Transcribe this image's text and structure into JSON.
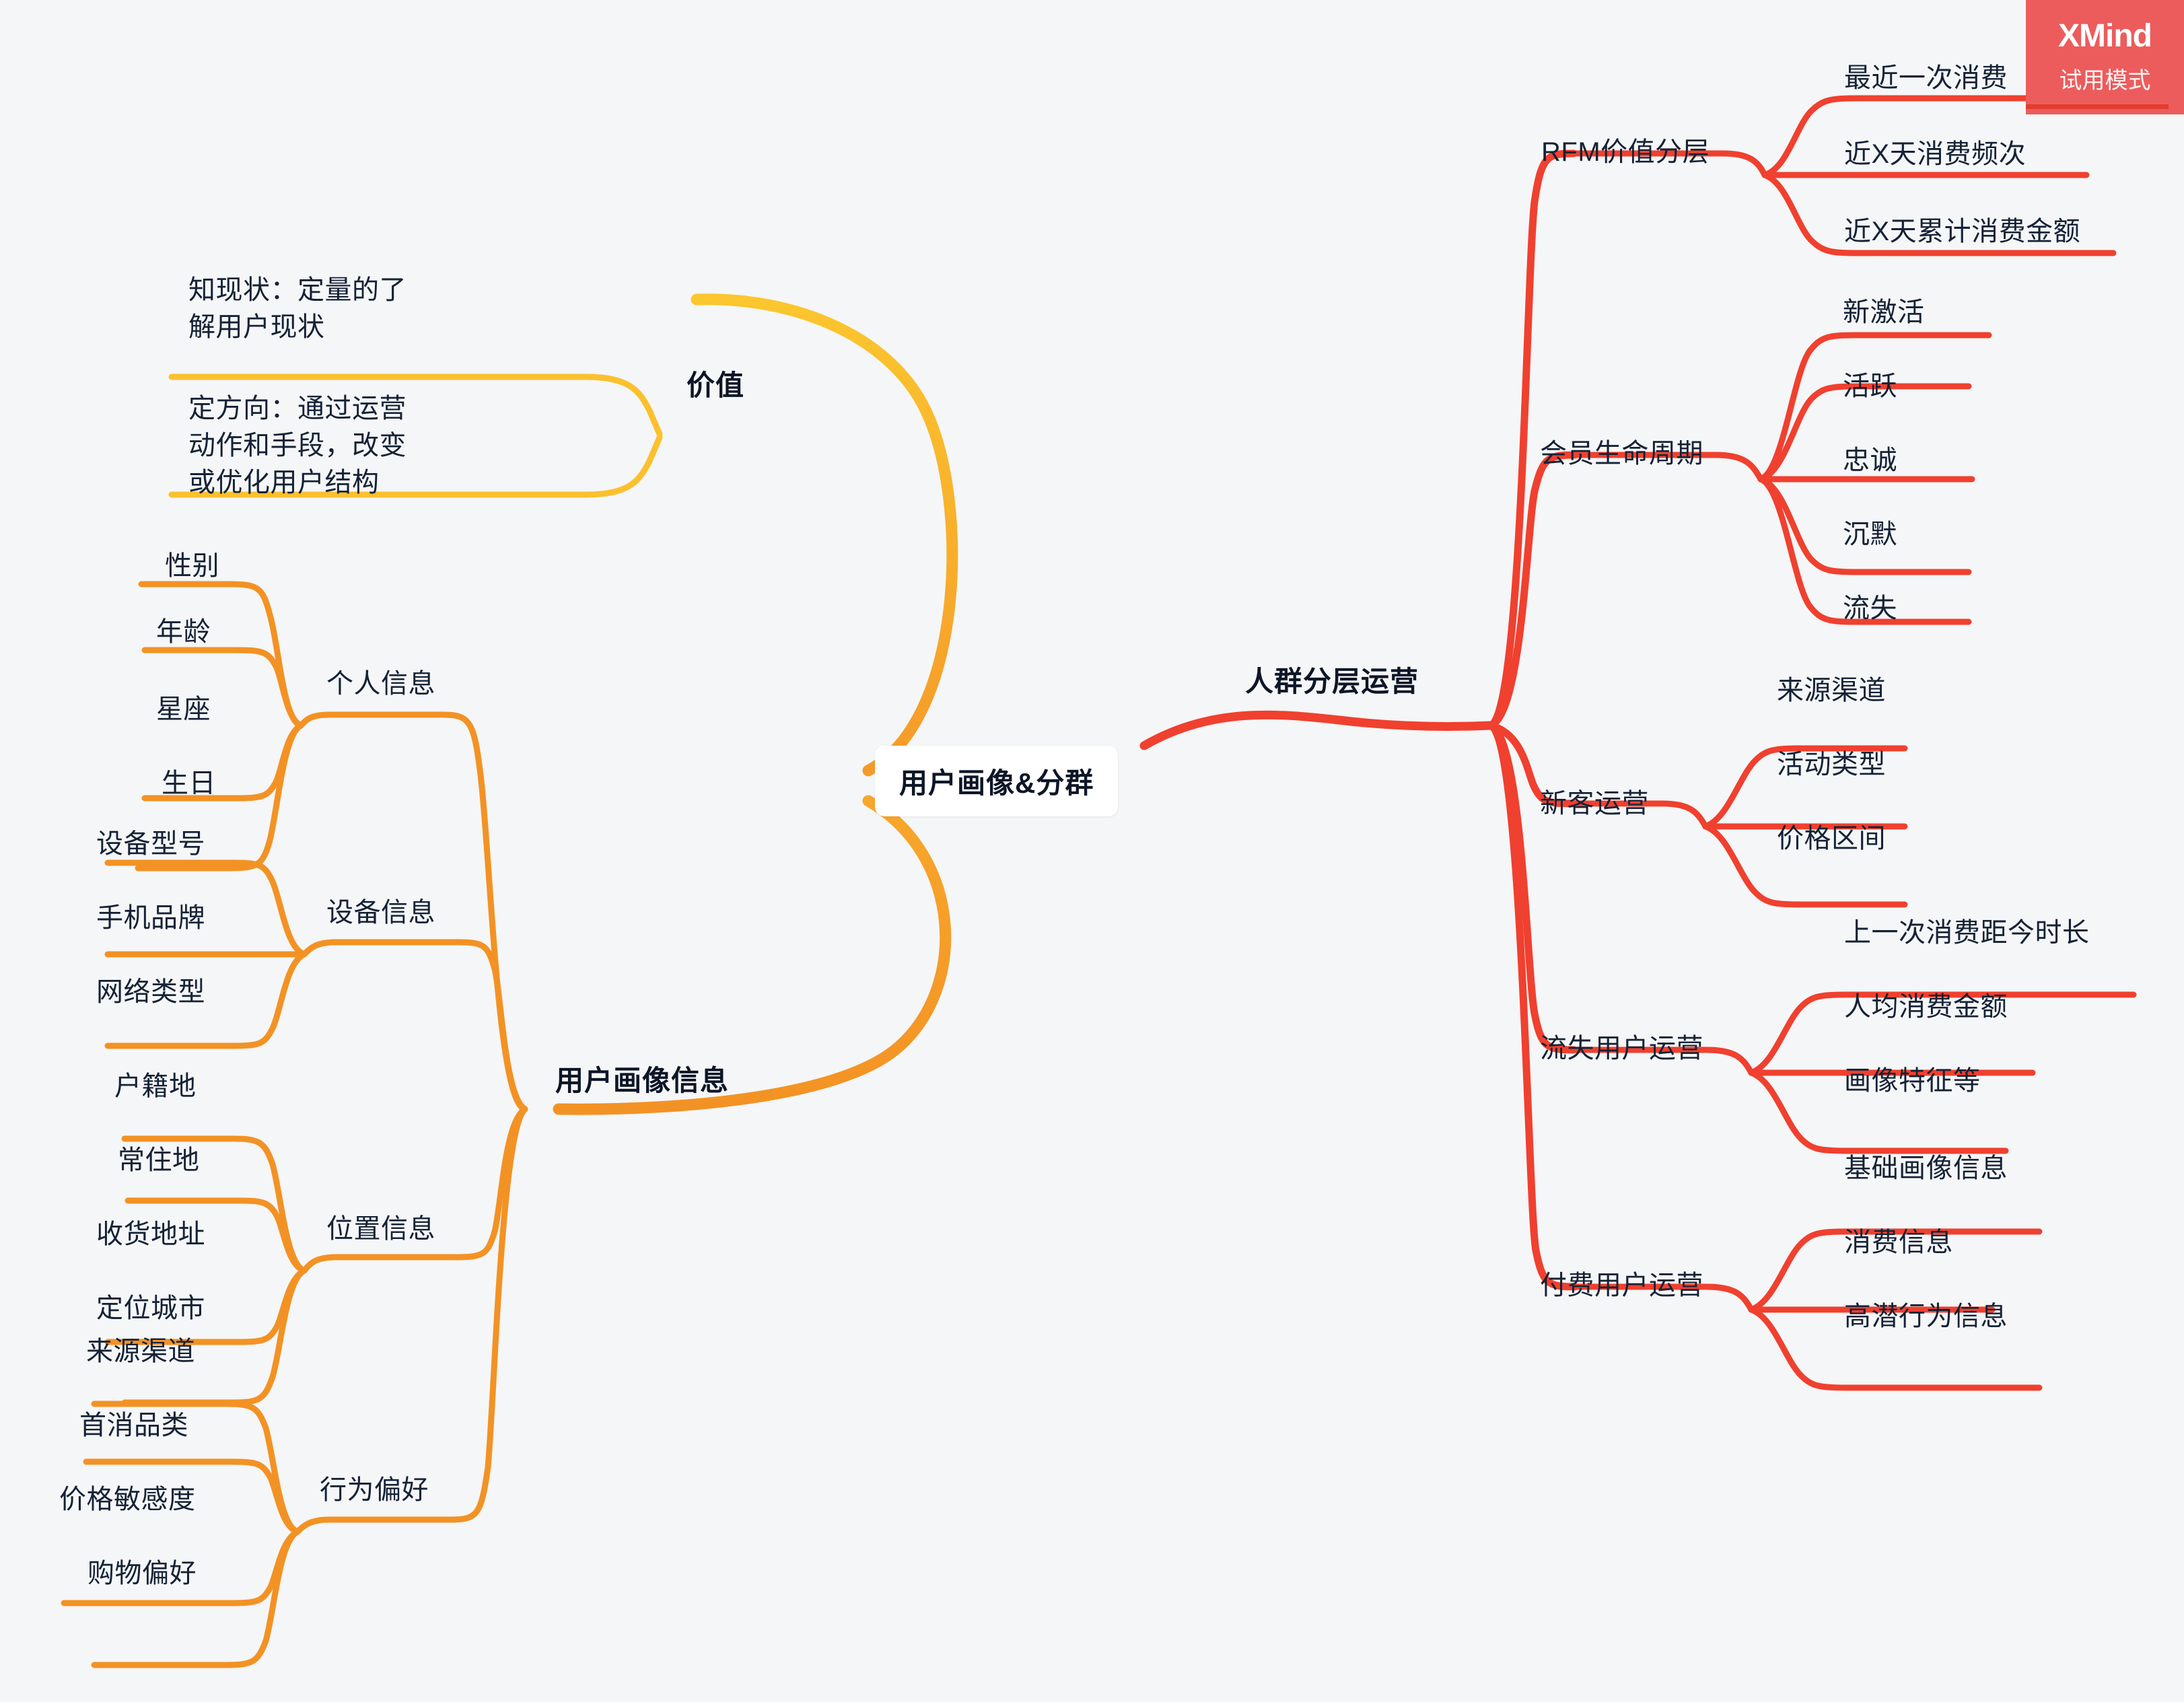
{
  "app": {
    "watermark_logo": "XMind",
    "watermark_mode": "试用模式"
  },
  "root": {
    "label": "用户画像&分群"
  },
  "colors": {
    "background": "#f5f6f7",
    "value_branch": "#fbc02d",
    "profile_branch": "#f39224",
    "segmentation_branch": "#f0402f",
    "text": "#152236",
    "root_bg": "#ffffff",
    "watermark_bg": "#ec5c5c"
  },
  "branches": [
    {
      "id": "value",
      "label": "价值",
      "side": "left",
      "color": "#fbc02d",
      "children": [
        {
          "label": "知现状：定量的了解用户现状"
        },
        {
          "label": "定方向：通过运营动作和手段，改变或优化用户结构"
        }
      ]
    },
    {
      "id": "profile",
      "label": "用户画像信息",
      "side": "left",
      "color": "#f39224",
      "children": [
        {
          "label": "个人信息",
          "leaves": [
            "性别",
            "年龄",
            "星座",
            "生日"
          ]
        },
        {
          "label": "设备信息",
          "leaves": [
            "设备型号",
            "手机品牌",
            "网络类型"
          ]
        },
        {
          "label": "位置信息",
          "leaves": [
            "户籍地",
            "常住地",
            "收货地址",
            "定位城市"
          ]
        },
        {
          "label": "行为偏好",
          "leaves": [
            "来源渠道",
            "首消品类",
            "价格敏感度",
            "购物偏好"
          ]
        }
      ]
    },
    {
      "id": "segmentation",
      "label": "人群分层运营",
      "side": "right",
      "color": "#f0402f",
      "children": [
        {
          "label": "RFM价值分层",
          "leaves": [
            "最近一次消费",
            "近X天消费频次",
            "近X天累计消费金额"
          ]
        },
        {
          "label": "会员生命周期",
          "leaves": [
            "新激活",
            "活跃",
            "忠诚",
            "沉默",
            "流失"
          ]
        },
        {
          "label": "新客运营",
          "leaves": [
            "来源渠道",
            "活动类型",
            "价格区间"
          ]
        },
        {
          "label": "流失用户运营",
          "leaves": [
            "上一次消费距今时长",
            "人均消费金额",
            "画像特征等"
          ]
        },
        {
          "label": "付费用户运营",
          "leaves": [
            "基础画像信息",
            "消费信息",
            "高潜行为信息"
          ]
        }
      ]
    }
  ]
}
